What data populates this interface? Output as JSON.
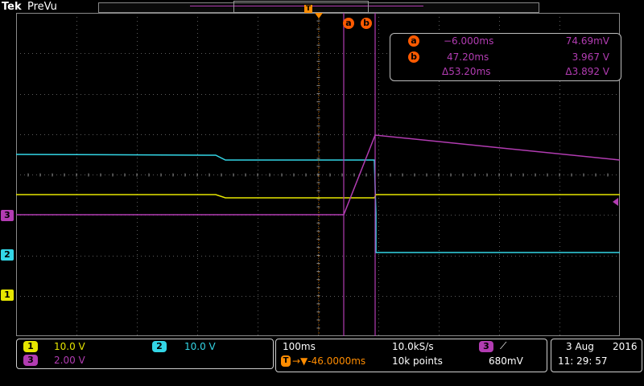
{
  "header": {
    "brand": "Tek",
    "mode": "PreVu",
    "trigger_marker": "T"
  },
  "cursors": {
    "a_label": "a",
    "b_label": "b"
  },
  "readout": {
    "a": {
      "label": "a",
      "time": "−6.000ms",
      "value": "74.69mV"
    },
    "b": {
      "label": "b",
      "time": "47.20ms",
      "value": "3.967 V"
    },
    "delta": {
      "time": "Δ53.20ms",
      "value": "Δ3.892 V"
    }
  },
  "channels": [
    {
      "id": "1",
      "scale": "10.0 V",
      "color": "#e6e600"
    },
    {
      "id": "2",
      "scale": "10.0 V",
      "color": "#33d6e6"
    },
    {
      "id": "3",
      "scale": "2.00 V",
      "color": "#b23cb2"
    }
  ],
  "channel_markers": [
    "3",
    "2",
    "1"
  ],
  "timebase": {
    "horizontal": "100ms",
    "sample_rate": "10.0kS/s",
    "trigger_position": "→▼-46.0000ms",
    "record_length": "10k points"
  },
  "trigger": {
    "source": "3",
    "slope": "⟋",
    "level": "680mV"
  },
  "datetime": {
    "date": "3 Aug",
    "year": "2016",
    "time": "11: 29: 57"
  },
  "colors": {
    "ch1": "#e6e600",
    "ch2": "#33d6e6",
    "ch3": "#b23cb2",
    "cursor_badge": "#ff5a00",
    "trigger": "#ff8c00",
    "grid": "#6a6a6a"
  }
}
